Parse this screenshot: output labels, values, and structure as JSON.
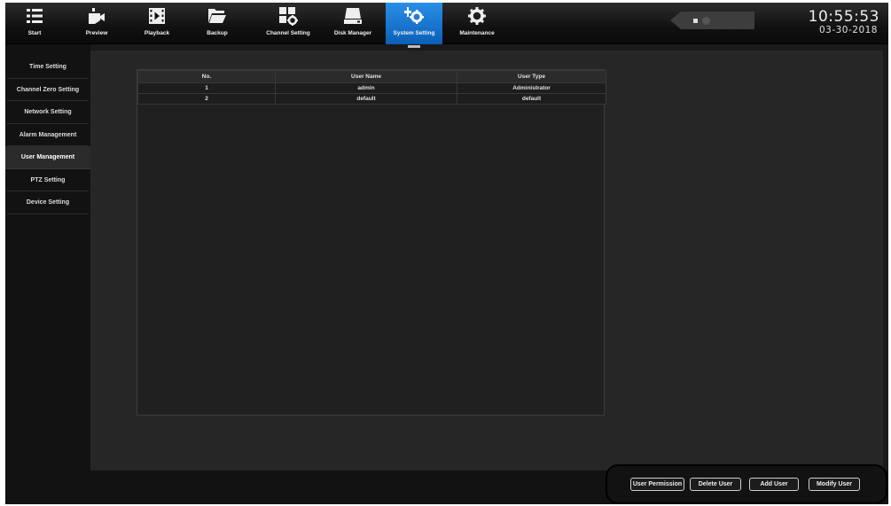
{
  "nav": {
    "items": [
      {
        "label": "Start",
        "icon": "list-icon"
      },
      {
        "label": "Preview",
        "icon": "camera-icon"
      },
      {
        "label": "Playback",
        "icon": "playback-icon"
      },
      {
        "label": "Backup",
        "icon": "folder-icon"
      },
      {
        "label": "Channel Setting",
        "icon": "channel-icon"
      },
      {
        "label": "Disk Manager",
        "icon": "disk-icon"
      },
      {
        "label": "System Setting",
        "icon": "system-gear-icon",
        "active": true
      },
      {
        "label": "Maintenance",
        "icon": "gear-icon"
      }
    ]
  },
  "clock": {
    "time": "10:55:53",
    "date": "03-30-2018"
  },
  "sidebar": {
    "items": [
      {
        "label": "Time Setting"
      },
      {
        "label": "Channel Zero Setting"
      },
      {
        "label": "Network Setting"
      },
      {
        "label": "Alarm Management"
      },
      {
        "label": "User Management",
        "active": true
      },
      {
        "label": "PTZ Setting"
      },
      {
        "label": "Device Setting"
      }
    ]
  },
  "table": {
    "headers": [
      "No.",
      "User Name",
      "User Type"
    ],
    "rows": [
      [
        "1",
        "admin",
        "Administrator"
      ],
      [
        "2",
        "default",
        "default"
      ]
    ]
  },
  "buttons": {
    "user_permission": "User Permission",
    "delete_user": "Delete User",
    "add_user": "Add User",
    "modify_user": "Modify User"
  },
  "colors": {
    "accent": "#1a7ad9",
    "background": "#1a1a1a"
  }
}
